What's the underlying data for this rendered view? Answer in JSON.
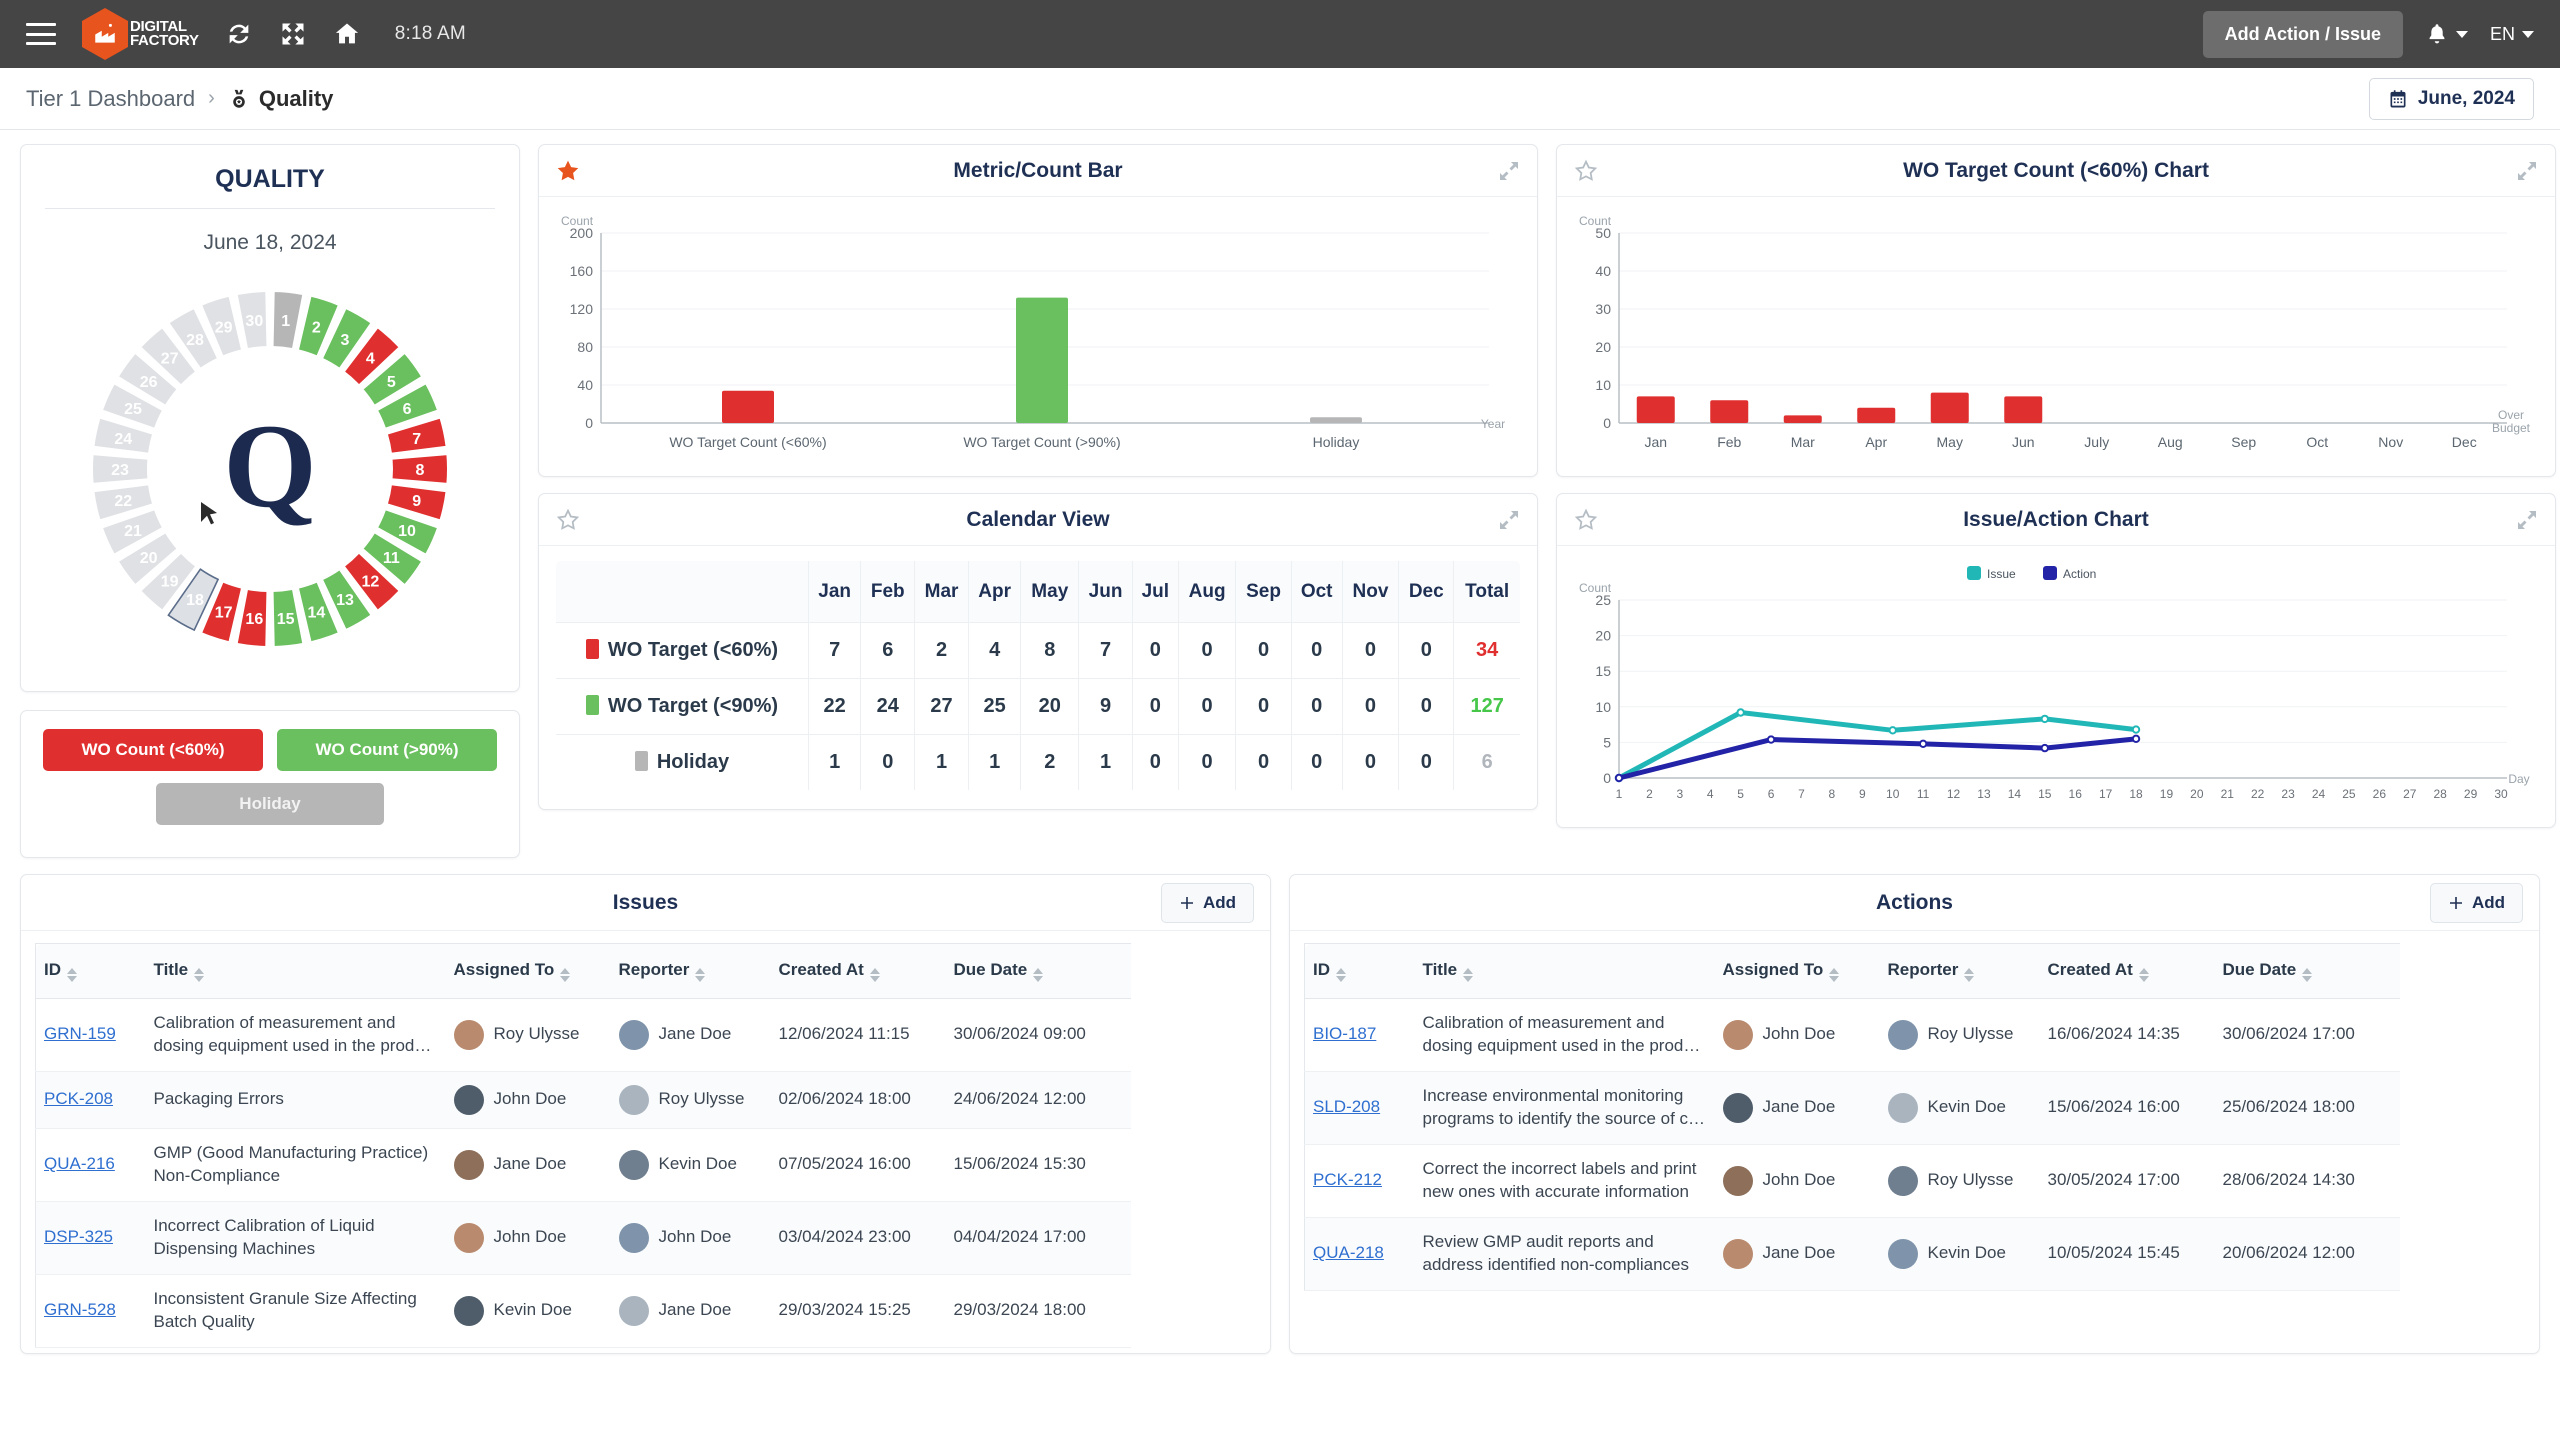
{
  "topbar": {
    "menu_icon": "hamburger-icon",
    "brand_line1": "DIGITAL",
    "brand_line2": "FACTORY",
    "refresh_icon": "refresh-icon",
    "expand_icon": "expand-arrows-icon",
    "home_icon": "home-icon",
    "time": "8:18 AM",
    "add_action_label": "Add Action / Issue",
    "bell_icon": "bell-icon",
    "language": "EN"
  },
  "breadcrumb": {
    "parent": "Tier 1 Dashboard",
    "separator": "›",
    "current": "Quality",
    "current_icon": "medal-icon",
    "date_label": "June, 2024",
    "calendar_icon": "calendar-icon"
  },
  "quality": {
    "title": "QUALITY",
    "date": "June 18, 2024",
    "center_letter": "Q",
    "selected_day": 18,
    "days": [
      {
        "day": 1,
        "status": "holiday"
      },
      {
        "day": 2,
        "status": "good"
      },
      {
        "day": 3,
        "status": "good"
      },
      {
        "day": 4,
        "status": "bad"
      },
      {
        "day": 5,
        "status": "good"
      },
      {
        "day": 6,
        "status": "good"
      },
      {
        "day": 7,
        "status": "bad"
      },
      {
        "day": 8,
        "status": "bad"
      },
      {
        "day": 9,
        "status": "bad"
      },
      {
        "day": 10,
        "status": "good"
      },
      {
        "day": 11,
        "status": "good"
      },
      {
        "day": 12,
        "status": "bad"
      },
      {
        "day": 13,
        "status": "good"
      },
      {
        "day": 14,
        "status": "good"
      },
      {
        "day": 15,
        "status": "good"
      },
      {
        "day": 16,
        "status": "bad"
      },
      {
        "day": 17,
        "status": "bad"
      },
      {
        "day": 18,
        "status": "selected"
      },
      {
        "day": 19,
        "status": "future"
      },
      {
        "day": 20,
        "status": "future"
      },
      {
        "day": 21,
        "status": "future"
      },
      {
        "day": 22,
        "status": "future"
      },
      {
        "day": 23,
        "status": "future"
      },
      {
        "day": 24,
        "status": "future"
      },
      {
        "day": 25,
        "status": "future"
      },
      {
        "day": 26,
        "status": "future"
      },
      {
        "day": 27,
        "status": "future"
      },
      {
        "day": 28,
        "status": "future"
      },
      {
        "day": 29,
        "status": "future"
      },
      {
        "day": 30,
        "status": "future"
      }
    ],
    "legend": {
      "red_label": "WO Count (<60%)",
      "green_label": "WO Count (>90%)",
      "gray_label": "Holiday"
    }
  },
  "colors": {
    "red": "#e02f2f",
    "green": "#6abf5e",
    "gray": "#b6b6b6",
    "future": "#dfe1e4",
    "issue_teal": "#21b7b7",
    "action_navy": "#2323a8",
    "accent_orange": "#e8541e",
    "navy_text": "#1f3055"
  },
  "panels": {
    "metric_count_bar": {
      "title": "Metric/Count Bar",
      "star_icon": "star-filled-icon",
      "starred": true,
      "expand_icon": "expand-diagonal-icon"
    },
    "wo_target_chart": {
      "title": "WO Target Count (<60%) Chart",
      "star_icon": "star-outline-icon",
      "starred": false,
      "expand_icon": "expand-diagonal-icon"
    },
    "calendar_view": {
      "title": "Calendar View",
      "star_icon": "star-outline-icon",
      "starred": false,
      "expand_icon": "expand-diagonal-icon"
    },
    "issue_action_chart": {
      "title": "Issue/Action Chart",
      "star_icon": "star-outline-icon",
      "starred": false,
      "expand_icon": "expand-diagonal-icon"
    }
  },
  "chart_data": [
    {
      "id": "metric_count_bar",
      "type": "bar",
      "title": "Metric/Count Bar",
      "categories": [
        "WO Target Count (<60%)",
        "WO Target Count (>90%)",
        "Holiday"
      ],
      "values": [
        34,
        132,
        6
      ],
      "colors": [
        "#e02f2f",
        "#6abf5e",
        "#b6b6b6"
      ],
      "ylabel": "Count",
      "xlabel": "Year",
      "ylim": [
        0,
        200
      ],
      "yticks": [
        0,
        40,
        80,
        120,
        160,
        200
      ],
      "grid": true,
      "legend": "none"
    },
    {
      "id": "wo_target_count_chart",
      "type": "bar",
      "title": "WO Target Count (<60%) Chart",
      "categories": [
        "Jan",
        "Feb",
        "Mar",
        "Apr",
        "May",
        "Jun",
        "July",
        "Aug",
        "Sep",
        "Oct",
        "Nov",
        "Dec"
      ],
      "values": [
        7,
        6,
        2,
        4,
        8,
        7,
        0,
        0,
        0,
        0,
        0,
        0
      ],
      "color": "#e02f2f",
      "ylabel": "Count",
      "xlabel": "Over Budget",
      "ylim": [
        0,
        50
      ],
      "yticks": [
        0,
        10,
        20,
        30,
        40,
        50
      ],
      "grid": true,
      "legend": "none"
    },
    {
      "id": "issue_action_chart",
      "type": "line",
      "title": "Issue/Action Chart",
      "x": [
        1,
        2,
        3,
        4,
        5,
        6,
        7,
        8,
        9,
        10,
        11,
        12,
        13,
        14,
        15,
        16,
        17,
        18,
        19,
        20,
        21,
        22,
        23,
        24,
        25,
        26,
        27,
        28,
        29,
        30
      ],
      "series": [
        {
          "name": "Issue",
          "color": "#21b7b7",
          "points": [
            [
              1,
              0
            ],
            [
              5,
              9.2
            ],
            [
              10,
              6.7
            ],
            [
              15,
              8.3
            ],
            [
              18,
              6.8
            ]
          ]
        },
        {
          "name": "Action",
          "color": "#2323a8",
          "points": [
            [
              1,
              0
            ],
            [
              6,
              5.4
            ],
            [
              11,
              4.8
            ],
            [
              15,
              4.2
            ],
            [
              18,
              5.5
            ]
          ]
        }
      ],
      "ylabel": "Count",
      "xlabel": "Day",
      "ylim": [
        0,
        25
      ],
      "yticks": [
        0,
        5,
        10,
        15,
        20,
        25
      ],
      "grid": true,
      "legend": "top-center"
    },
    {
      "id": "calendar_view",
      "type": "table",
      "title": "Calendar View",
      "columns": [
        "",
        "Jan",
        "Feb",
        "Mar",
        "Apr",
        "May",
        "Jun",
        "Jul",
        "Aug",
        "Sep",
        "Oct",
        "Nov",
        "Dec",
        "Total"
      ],
      "rows": [
        {
          "label": "WO Target (<60%)",
          "swatch": "#e02f2f",
          "values": [
            7,
            6,
            2,
            4,
            8,
            7,
            0,
            0,
            0,
            0,
            0,
            0
          ],
          "total": 34,
          "total_color": "#e02f2f"
        },
        {
          "label": "WO Target (<90%)",
          "swatch": "#6abf5e",
          "values": [
            22,
            24,
            27,
            25,
            20,
            9,
            0,
            0,
            0,
            0,
            0,
            0
          ],
          "total": 127,
          "total_color": "#46c74a"
        },
        {
          "label": "Holiday",
          "swatch": "#b6b6b6",
          "values": [
            1,
            0,
            1,
            1,
            2,
            1,
            0,
            0,
            0,
            0,
            0,
            0
          ],
          "total": 6,
          "total_color": "#b0b6bc"
        }
      ]
    }
  ],
  "issues": {
    "title": "Issues",
    "add_label": "Add",
    "add_icon": "plus-icon",
    "columns": [
      "ID",
      "Title",
      "Assigned To",
      "Reporter",
      "Created At",
      "Due Date"
    ],
    "rows": [
      {
        "id": "GRN-159",
        "title": "Calibration of measurement and dosing equipment used in the prod…",
        "assigned_to": "Roy Ulysse",
        "reporter": "Jane Doe",
        "created_at": "12/06/2024 11:15",
        "due_date": "30/06/2024 09:00"
      },
      {
        "id": "PCK-208",
        "title": "Packaging Errors",
        "assigned_to": "John Doe",
        "reporter": "Roy Ulysse",
        "created_at": "02/06/2024 18:00",
        "due_date": "24/06/2024 12:00"
      },
      {
        "id": "QUA-216",
        "title": "GMP (Good Manufacturing Practice) Non-Compliance",
        "assigned_to": "Jane Doe",
        "reporter": "Kevin Doe",
        "created_at": "07/05/2024 16:00",
        "due_date": "15/06/2024 15:30"
      },
      {
        "id": "DSP-325",
        "title": "Incorrect Calibration of Liquid Dispensing Machines",
        "assigned_to": "John Doe",
        "reporter": "John Doe",
        "created_at": "03/04/2024 23:00",
        "due_date": "04/04/2024 17:00"
      },
      {
        "id": "GRN-528",
        "title": "Inconsistent Granule Size Affecting Batch Quality",
        "assigned_to": "Kevin Doe",
        "reporter": "Jane Doe",
        "created_at": "29/03/2024 15:25",
        "due_date": "29/03/2024 18:00"
      }
    ]
  },
  "actions": {
    "title": "Actions",
    "add_label": "Add",
    "add_icon": "plus-icon",
    "columns": [
      "ID",
      "Title",
      "Assigned To",
      "Reporter",
      "Created At",
      "Due Date"
    ],
    "rows": [
      {
        "id": "BIO-187",
        "title": "Calibration of measurement and dosing equipment used in the prod…",
        "assigned_to": "John Doe",
        "reporter": "Roy Ulysse",
        "created_at": "16/06/2024 14:35",
        "due_date": "30/06/2024 17:00"
      },
      {
        "id": "SLD-208",
        "title": "Increase environmental monitoring programs to identify the source of c…",
        "assigned_to": "Jane Doe",
        "reporter": "Kevin Doe",
        "created_at": "15/06/2024 16:00",
        "due_date": "25/06/2024 18:00"
      },
      {
        "id": "PCK-212",
        "title": "Correct the incorrect labels and print new ones with accurate information",
        "assigned_to": "John Doe",
        "reporter": "Roy Ulysse",
        "created_at": "30/05/2024 17:00",
        "due_date": "28/06/2024 14:30"
      },
      {
        "id": "QUA-218",
        "title": "Review GMP audit reports and address identified non-compliances",
        "assigned_to": "Jane Doe",
        "reporter": "Kevin Doe",
        "created_at": "10/05/2024 15:45",
        "due_date": "20/06/2024 12:00"
      }
    ]
  }
}
